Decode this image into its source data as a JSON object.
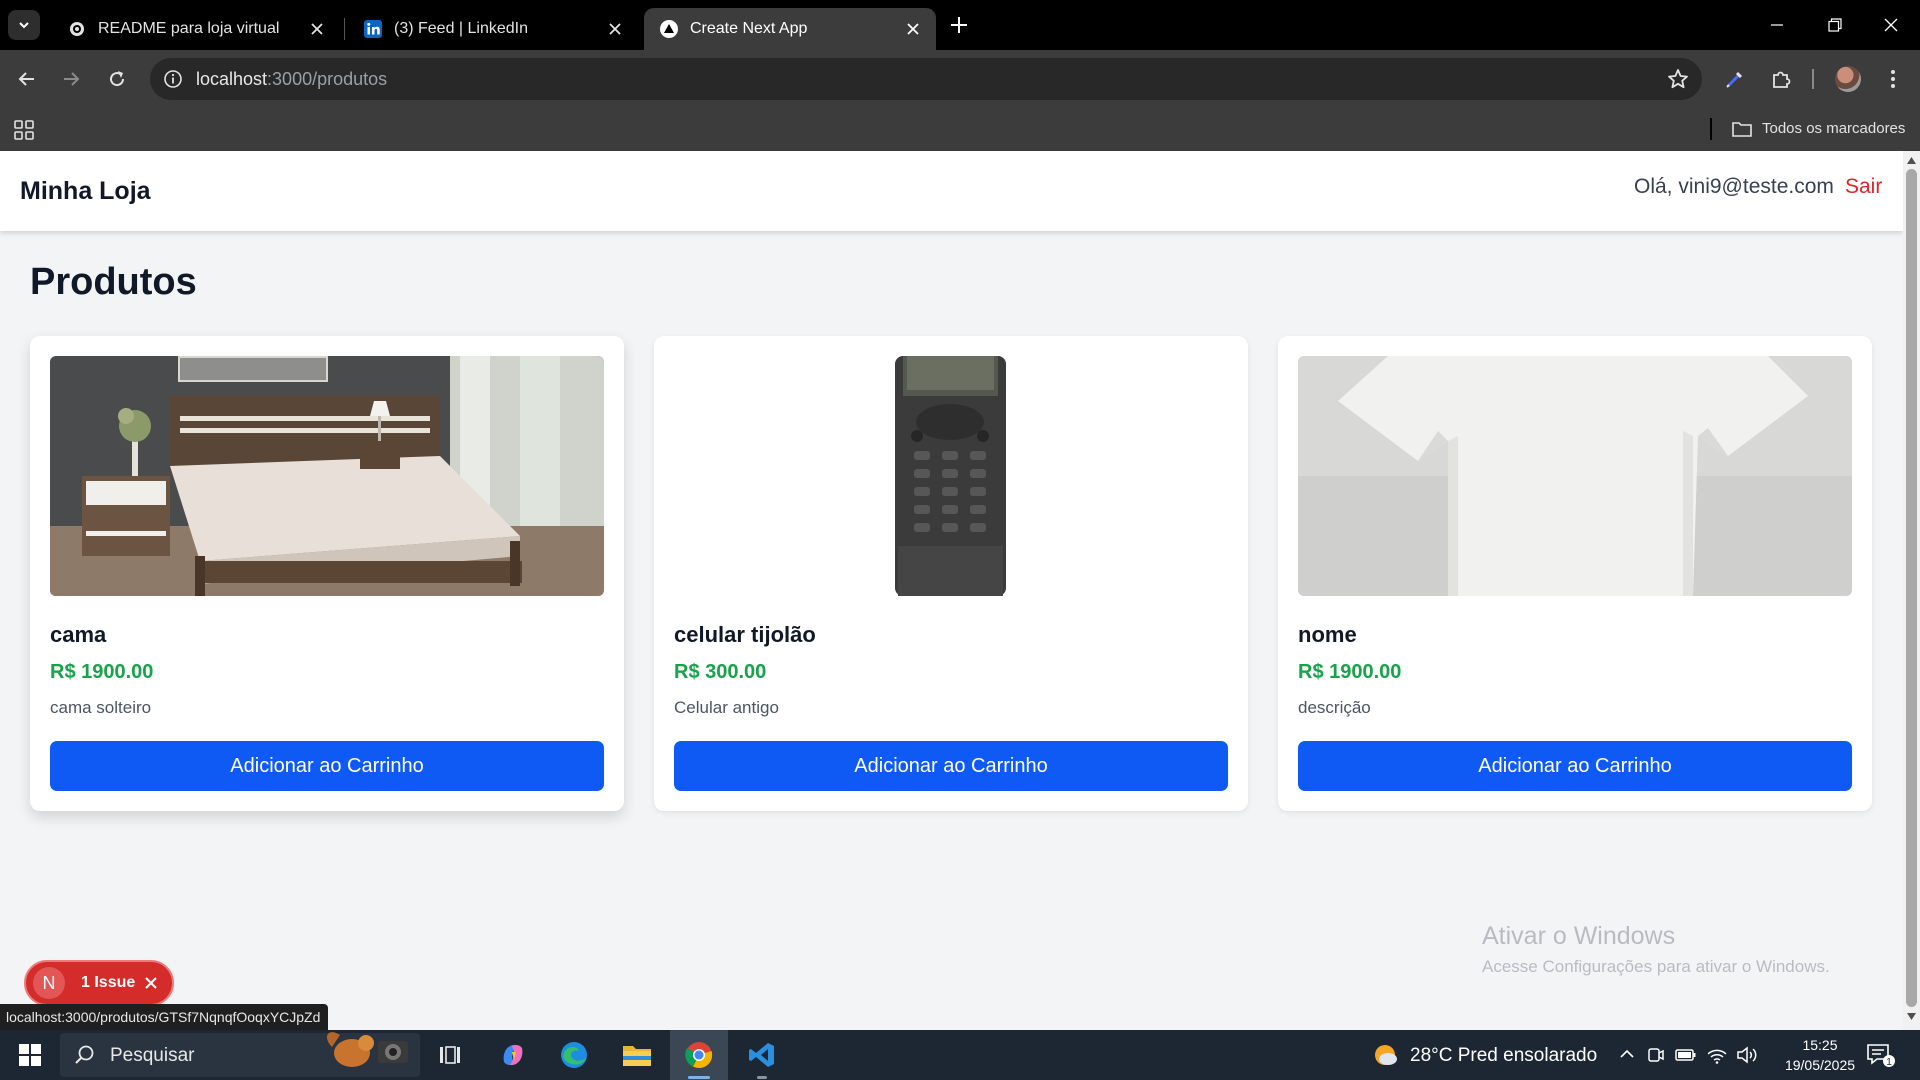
{
  "browser": {
    "tabs": [
      {
        "title": "README para loja virtual",
        "icon": "github-icon",
        "active": false
      },
      {
        "title": "(3) Feed | LinkedIn",
        "icon": "linkedin-icon",
        "active": false
      },
      {
        "title": "Create Next App",
        "icon": "nextjs-icon",
        "active": true
      }
    ],
    "url_host": "localhost",
    "url_path": ":3000/produtos",
    "bookmarks_label": "Todos os marcadores",
    "status_url": "localhost:3000/produtos/GTSf7NqnqfOoqxYCJpZd"
  },
  "site": {
    "brand": "Minha Loja",
    "greeting": "Olá, vini9@teste.com",
    "logout_label": "Sair",
    "heading": "Produtos",
    "button_label": "Adicionar ao Carrinho",
    "products": [
      {
        "name": "cama",
        "price": "R$ 1900.00",
        "description": "cama solteiro",
        "image": "bed-photo"
      },
      {
        "name": "celular tijolão",
        "price": "R$ 300.00",
        "description": "Celular antigo",
        "image": "old-phone-photo"
      },
      {
        "name": "nome",
        "price": "R$ 1900.00",
        "description": "descrição",
        "image": "white-tshirt-photo"
      }
    ]
  },
  "dev_overlay": {
    "logo_letter": "N",
    "issues_label": "1 Issue"
  },
  "watermark": {
    "title": "Ativar o Windows",
    "subtitle": "Acesse Configurações para ativar o Windows."
  },
  "taskbar": {
    "search_placeholder": "Pesquisar",
    "weather": "28°C  Pred ensolarado",
    "time": "15:25",
    "date": "19/05/2025",
    "notification_count": "1"
  },
  "colors": {
    "primary_button": "#0f5af5",
    "price": "#16a34a",
    "logout": "#dc2626",
    "issue_pill": "#d42b2b"
  }
}
